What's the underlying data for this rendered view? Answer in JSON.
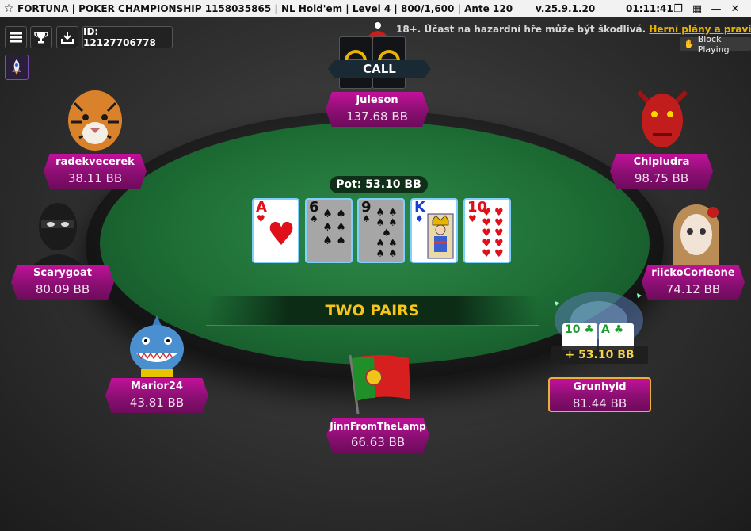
{
  "titlebar": {
    "title": "FORTUNA | POKER CHAMPIONSHIP 1158035865 | NL Hold'em | Level 4 | 800/1,600 | Ante 120",
    "version": "v.25.9.1.20",
    "time": "01:11:41"
  },
  "toolbar": {
    "id_text": "ID: 12127706778"
  },
  "notice": {
    "text": "18+. Účast na hazardní hře může být škodlivá.",
    "link": "Herní plány a pravidla"
  },
  "block_playing": "Block Playing",
  "pot": "Pot: 53.10 BB",
  "board": [
    {
      "rank": "A",
      "suit": "♥",
      "color": "red"
    },
    {
      "rank": "6",
      "suit": "♠",
      "color": "black"
    },
    {
      "rank": "9",
      "suit": "♠",
      "color": "black"
    },
    {
      "rank": "K",
      "suit": "♦",
      "color": "blue"
    },
    {
      "rank": "10",
      "suit": "♥",
      "color": "red"
    }
  ],
  "hand_result": "TWO PAIRS",
  "players": {
    "juleson": {
      "name": "Juleson",
      "stack": "137.68 BB",
      "action": "CALL"
    },
    "radekvecerek": {
      "name": "radekvecerek",
      "stack": "38.11 BB"
    },
    "chipludra": {
      "name": "Chipludra",
      "stack": "98.75 BB"
    },
    "scarygoat": {
      "name": "Scarygoat",
      "stack": "80.09 BB"
    },
    "riicko": {
      "name": "riickoCorleone",
      "stack": "74.12 BB"
    },
    "marior24": {
      "name": "Marior24",
      "stack": "43.81 BB"
    },
    "jinn": {
      "name": "JinnFromTheLamp",
      "stack": "66.63 BB"
    },
    "grunhyld": {
      "name": "Grunhyld",
      "stack": "81.44 BB",
      "win": "+ 53.10 BB",
      "cards": [
        "10",
        "A"
      ]
    }
  }
}
